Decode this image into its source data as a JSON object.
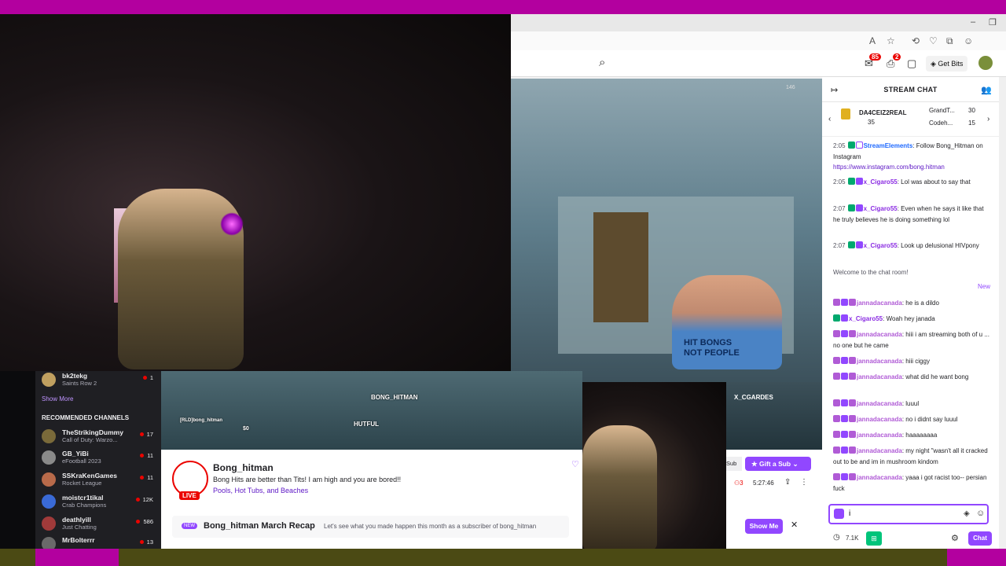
{
  "browser": {
    "icons": [
      "A",
      "☆",
      "⟲",
      "♡",
      "⧉",
      "☺"
    ]
  },
  "twitch_top": {
    "notifications_count": "85",
    "whispers_count": "2",
    "get_bits_label": "Get Bits"
  },
  "chat": {
    "title": "STREAM CHAT",
    "leaderboard": [
      {
        "name": "DA4CEIZ2REAL",
        "value": "35"
      },
      {
        "name": "GrandT...",
        "value": "30"
      },
      {
        "name": "Codeh...",
        "value": "15"
      }
    ],
    "messages": [
      {
        "ts": "2:05",
        "user": "StreamElements",
        "color": "#1e69ff",
        "text": ": Follow Bong_Hitman on Instagram",
        "link": "https://www.instagram.com/bong.hitman"
      },
      {
        "ts": "2:05",
        "user": "x_Cigaro55",
        "color": "#8a2be2",
        "text": ": Lol was about to say that"
      },
      {
        "ts": "2:07",
        "user": "x_Cigaro55",
        "color": "#8a2be2",
        "text": ": Even when he says it like that he truly believes he is doing something lol"
      },
      {
        "ts": "2:07",
        "user": "x_Cigaro55",
        "color": "#8a2be2",
        "text": ": Look up delusional HIVpony"
      }
    ],
    "welcome": "Welcome to the chat room!",
    "new_label": "New",
    "recent": [
      {
        "user": "jannadacanada",
        "color": "#b05bd6",
        "text": ": he is a dildo"
      },
      {
        "user": "x_Cigaro55",
        "color": "#8a2be2",
        "text": ": Woah hey janada"
      },
      {
        "user": "jannadacanada",
        "color": "#b05bd6",
        "text": ": hiii i am streaming both of u ... no one but he came"
      },
      {
        "user": "jannadacanada",
        "color": "#b05bd6",
        "text": ": hiii ciggy"
      },
      {
        "user": "jannadacanada",
        "color": "#b05bd6",
        "text": ": what did he want bong"
      },
      {
        "user": "jannadacanada",
        "color": "#b05bd6",
        "text": ": luuul"
      },
      {
        "user": "jannadacanada",
        "color": "#b05bd6",
        "text": ": no i didnt say luuul"
      },
      {
        "user": "jannadacanada",
        "color": "#b05bd6",
        "text": ": haaaaaaaa"
      },
      {
        "user": "jannadacanada",
        "color": "#b05bd6",
        "text": ": my night \"wasn't all it cracked out to be and im in mushroom kindom"
      },
      {
        "user": "jannadacanada",
        "color": "#b05bd6",
        "text": ": yaaa i got racist too-- persian fuck"
      }
    ],
    "input_value": "i",
    "points": "7.1K",
    "chat_button": "Chat"
  },
  "sidebar": {
    "followed": [
      {
        "name": "bk2tekg",
        "game": "Saints Row 2",
        "count": "1",
        "avatar": "#c0a060"
      }
    ],
    "show_more": "Show More",
    "recommended_title": "RECOMMENDED CHANNELS",
    "recommended": [
      {
        "name": "TheStrikingDummy",
        "game": "Call of Duty: Warzo...",
        "count": "17",
        "avatar": "#7a6a3a"
      },
      {
        "name": "GB_YiBi",
        "game": "eFootball 2023",
        "count": "11",
        "avatar": "#8a8a8a"
      },
      {
        "name": "SSKraKenGames",
        "game": "Rocket League",
        "count": "11",
        "avatar": "#b86a4a"
      },
      {
        "name": "moistcr1tikal",
        "game": "Crab Champions",
        "count": "12K",
        "avatar": "#3a6ad6"
      },
      {
        "name": "deathlyill",
        "game": "Just Chatting",
        "count": "586",
        "avatar": "#a03a3a"
      },
      {
        "name": "MrBolterrr",
        "game": "",
        "count": "13",
        "avatar": "#6a6a6a"
      }
    ]
  },
  "player": {
    "streamer_tag": "BONG_HITMAN",
    "hud_name": "HUTFUL",
    "opponent_tag": "X_CGARDES",
    "hud_money": "$0",
    "hud_player": "[RLD]bong_hitman"
  },
  "channel": {
    "name": "Bong_hitman",
    "title": "Bong Hits are better than Tits! I am high and you are bored!!",
    "tags": "Pools, Hot Tubs, and Beaches",
    "live_label": "LIVE",
    "recap_new": "NEW",
    "recap_heading": "Bong_hitman March Recap",
    "recap_text": "Let's see what you made happen this month as a subscriber of bong_hitman",
    "viewers": "3",
    "uptime": "5:27:46",
    "gift_sub": "Gift a Sub",
    "sub_label": "Sub",
    "show_me": "Show Me"
  },
  "game_hud": {
    "top_right": "146"
  }
}
